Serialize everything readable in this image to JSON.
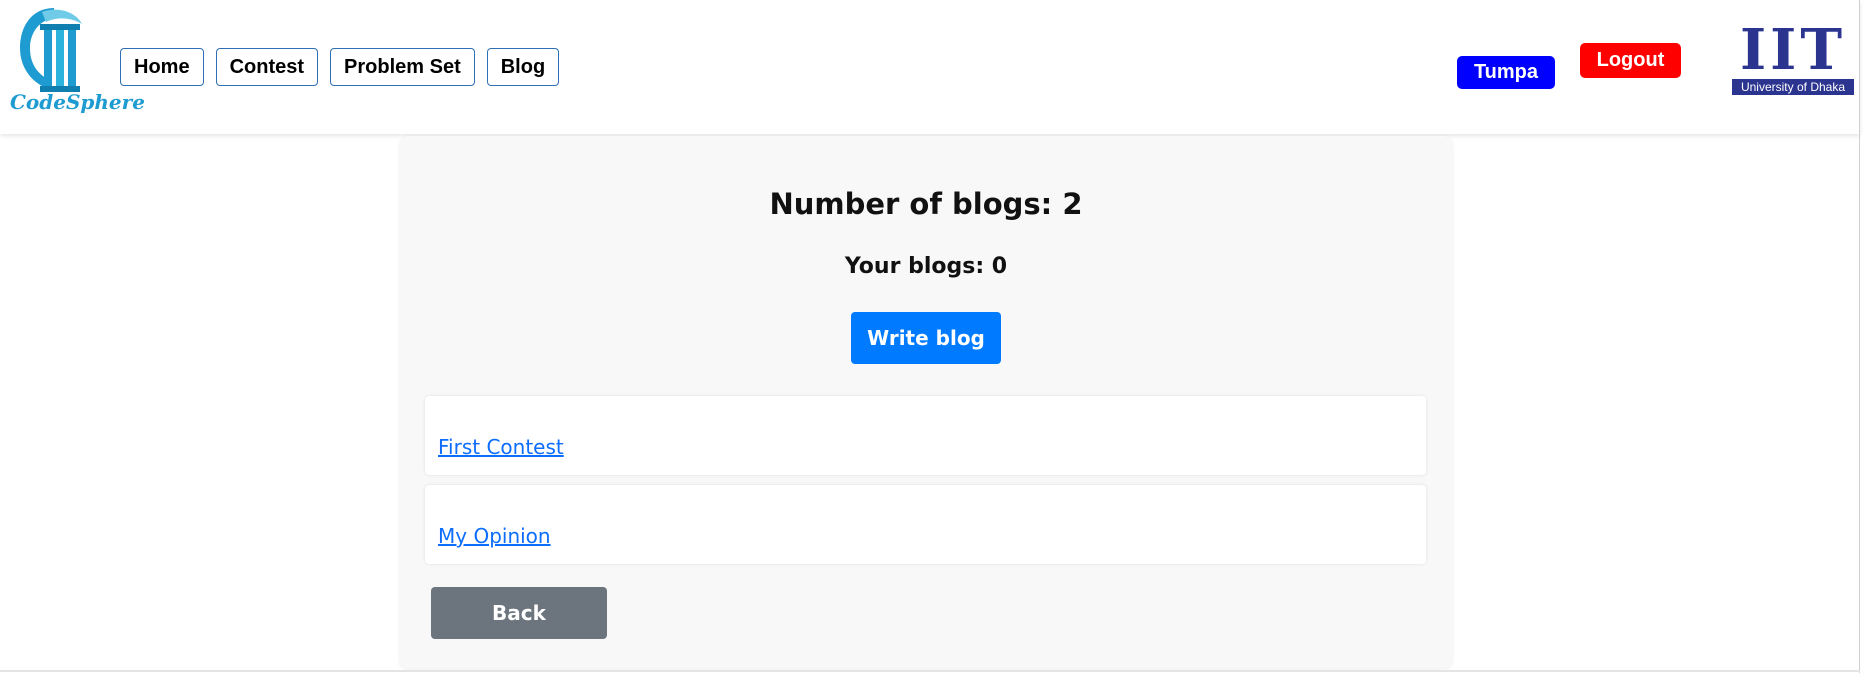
{
  "brand": {
    "name": "CodeSphere"
  },
  "nav": {
    "items": [
      "Home",
      "Contest",
      "Problem Set",
      "Blog"
    ]
  },
  "user": {
    "name": "Tumpa",
    "logout_label": "Logout"
  },
  "institute": {
    "letters": "IIT",
    "subtitle": "University of Dhaka"
  },
  "blogs": {
    "count_text": "Number of blogs: 2",
    "yours_text": "Your blogs: 0",
    "write_label": "Write blog",
    "items": [
      {
        "title": "First Contest"
      },
      {
        "title": "My Opinion"
      }
    ],
    "back_label": "Back"
  },
  "colors": {
    "brand_cyan": "#1e9bd0",
    "user_button": "#0000ff",
    "logout_button": "#ff0000",
    "iit_navy": "#2b3590",
    "primary": "#007bff",
    "secondary": "#6c757d"
  }
}
